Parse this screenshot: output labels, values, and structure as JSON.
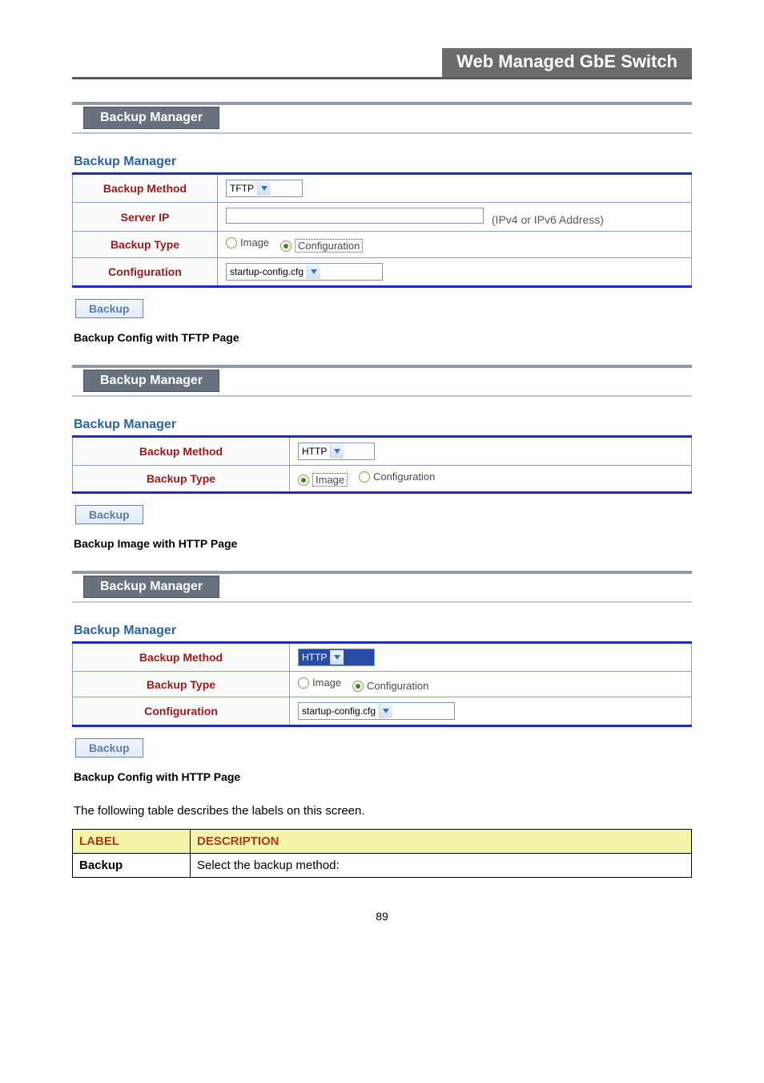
{
  "doc_header": "Web Managed GbE Switch",
  "widget_title": "Backup Manager",
  "section_title": "Backup Manager",
  "tftp": {
    "labels": {
      "method": "Backup Method",
      "server_ip": "Server IP",
      "backup_type": "Backup Type",
      "configuration": "Configuration"
    },
    "method_value": "TFTP",
    "server_ip_note": "(IPv4 or IPv6 Address)",
    "type_image": "Image",
    "type_config": "Configuration",
    "config_value": "startup-config.cfg",
    "button": "Backup",
    "caption": "Backup Config with TFTP Page"
  },
  "http_img": {
    "labels": {
      "method": "Backup Method",
      "backup_type": "Backup Type"
    },
    "method_value": "HTTP",
    "type_image": "Image",
    "type_config": "Configuration",
    "button": "Backup",
    "caption": "Backup Image with HTTP Page"
  },
  "http_cfg": {
    "labels": {
      "method": "Backup Method",
      "backup_type": "Backup Type",
      "configuration": "Configuration"
    },
    "method_value": "HTTP",
    "type_image": "Image",
    "type_config": "Configuration",
    "config_value": "startup-config.cfg",
    "button": "Backup",
    "caption": "Backup Config with HTTP Page"
  },
  "desc_intro": "The following table describes the labels on this screen.",
  "desc_table": {
    "head_label": "LABEL",
    "head_desc": "DESCRIPTION",
    "row1_label": "Backup",
    "row1_desc": "Select the backup method:"
  },
  "page_number": "89"
}
